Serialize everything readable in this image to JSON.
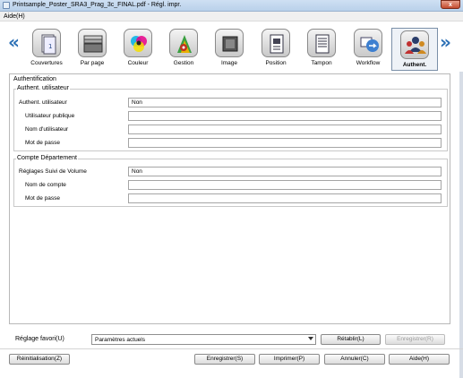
{
  "window": {
    "title": "Printsample_Poster_SRA3_Prag_3c_FINAL.pdf - Régl. impr.",
    "close_label": "x"
  },
  "menubar": {
    "help": "Aide(H)"
  },
  "toolbar": {
    "prev_arrow": "«",
    "next_arrow": "»",
    "items": [
      {
        "label": "Couvertures",
        "icon": "covers-icon"
      },
      {
        "label": "Par page",
        "icon": "per-page-icon"
      },
      {
        "label": "Couleur",
        "icon": "color-icon"
      },
      {
        "label": "Gestion",
        "icon": "management-icon"
      },
      {
        "label": "Image",
        "icon": "image-icon"
      },
      {
        "label": "Position",
        "icon": "position-icon"
      },
      {
        "label": "Tampon",
        "icon": "stamp-icon"
      },
      {
        "label": "Workflow",
        "icon": "workflow-icon"
      },
      {
        "label": "Authent.",
        "icon": "authentication-icon",
        "active": true
      }
    ]
  },
  "main": {
    "section_title": "Authentification",
    "user_auth": {
      "group_title": "Authent. utilisateur",
      "rows": [
        {
          "label": "Authent. utilisateur",
          "value": "Non"
        },
        {
          "label": "Utilisateur publique",
          "value": ""
        },
        {
          "label": "Nom d'utilisateur",
          "value": ""
        },
        {
          "label": "Mot de passe",
          "value": ""
        }
      ]
    },
    "dept": {
      "group_title": "Compte Département",
      "rows": [
        {
          "label": "Réglages Suivi de Volume",
          "value": "Non"
        },
        {
          "label": "Nom de compte",
          "value": ""
        },
        {
          "label": "Mot de passe",
          "value": ""
        }
      ]
    }
  },
  "favorites": {
    "label": "Réglage favori(U)",
    "selected": "Paramètres actuels",
    "restore": "Rétablir(L)",
    "save": "Enregistrer(R)"
  },
  "footer": {
    "reset": "Réinitialisation(Z)",
    "register": "Enregistrer(S)",
    "print": "Imprimer(P)",
    "cancel": "Annuler(C)",
    "help": "Aide(H)"
  }
}
